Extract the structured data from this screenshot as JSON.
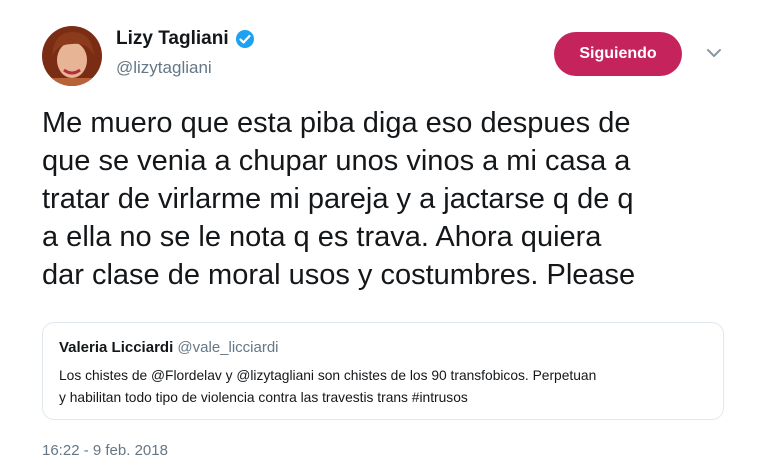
{
  "author": {
    "name": "Lizy Tagliani",
    "handle": "@lizytagliani",
    "verified": true
  },
  "follow_button": {
    "label": "Siguiendo",
    "color": "#c4245b"
  },
  "tweet": {
    "lines": [
      "Me muero que esta piba diga eso despues de",
      "que se venia a chupar unos vinos a mi casa a",
      "tratar de virlarme mi pareja y a jactarse q de q",
      "a ella no se le nota q es trava. Ahora quiera",
      "dar clase de moral usos y costumbres. Please"
    ],
    "timestamp": "16:22 - 9 feb. 2018"
  },
  "quoted_tweet": {
    "name": "Valeria Licciardi",
    "handle": "@vale_licciardi",
    "lines": [
      "Los chistes de @Flordelav y @lizytagliani son chistes de los 90 transfobicos. Perpetuan",
      "y habilitan todo tipo de violencia contra las travestis trans #intrusos"
    ]
  },
  "colors": {
    "verified_badge": "#1da1f2",
    "secondary_text": "#657786",
    "border": "#e1e8ed"
  },
  "icons": {
    "verified": "verified-badge-icon",
    "more": "chevron-down-icon"
  }
}
